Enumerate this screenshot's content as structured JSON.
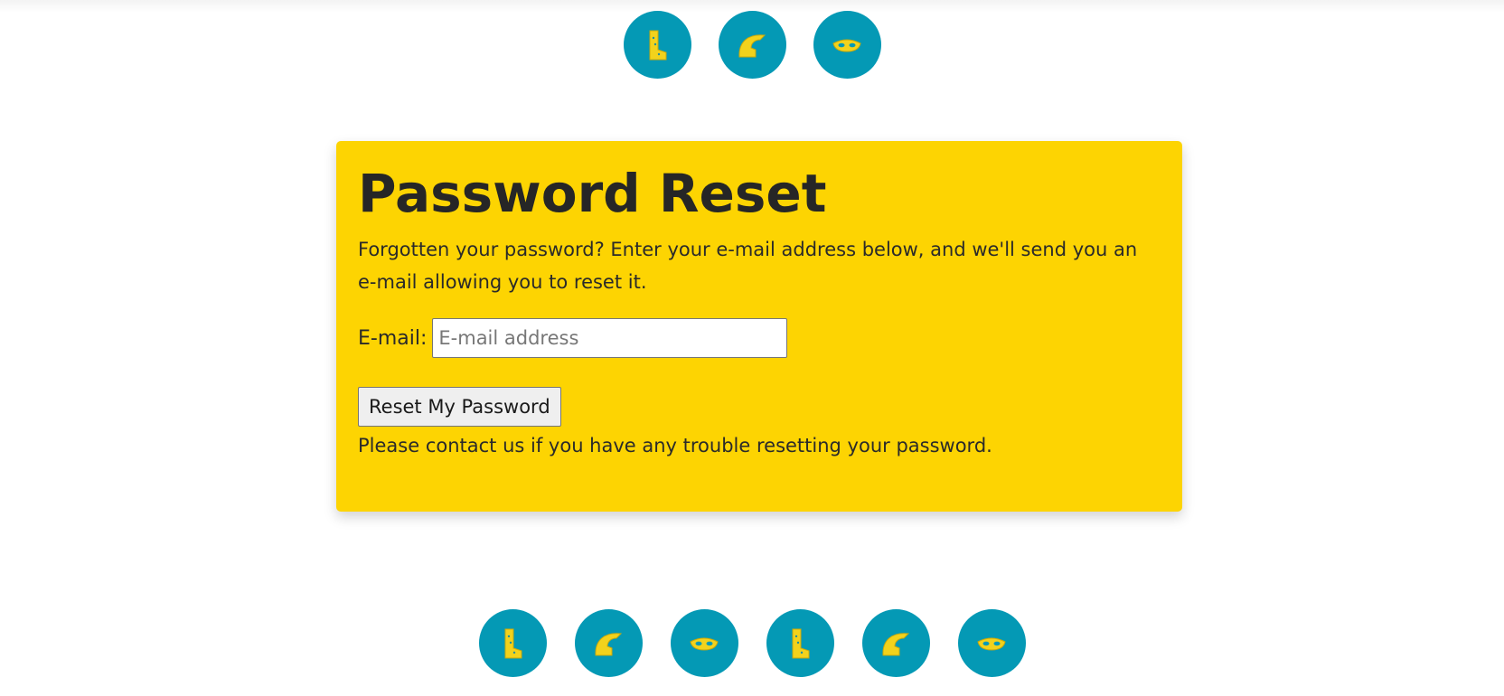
{
  "top_icons": [
    "boot-icon",
    "helmet-icon",
    "mask-icon"
  ],
  "bottom_icons": [
    "boot-icon",
    "helmet-icon",
    "mask-icon",
    "boot-icon",
    "helmet-icon",
    "mask-icon"
  ],
  "form": {
    "title": "Password Reset",
    "intro": "Forgotten your password? Enter your e-mail address below, and we'll send you an e-mail allowing you to reset it.",
    "email_label": "E-mail:",
    "email_placeholder": "E-mail address",
    "email_value": "",
    "submit_label": "Reset My Password",
    "contact_text": "Please contact us if you have any trouble resetting your password."
  },
  "colors": {
    "card_background": "#fdd402",
    "icon_circle": "#0499b5",
    "icon_fill": "#f2d21c"
  }
}
